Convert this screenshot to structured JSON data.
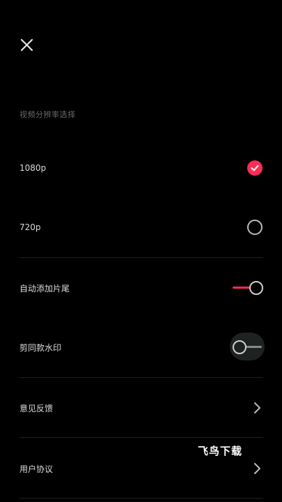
{
  "header": {
    "close_icon": "close-icon"
  },
  "resolution": {
    "section_title": "视频分辨率选择",
    "options": [
      {
        "label": "1080p",
        "selected": true
      },
      {
        "label": "720p",
        "selected": false
      }
    ]
  },
  "toggles": [
    {
      "label": "自动添加片尾",
      "on": true
    },
    {
      "label": "剪同款水印",
      "on": false
    }
  ],
  "links": [
    {
      "label": "意见反馈",
      "icon": "chevron-right-icon"
    },
    {
      "label": "用户协议",
      "icon": "chevron-right-icon"
    }
  ],
  "overlay": {
    "watermark": "飞鸟下载"
  },
  "colors": {
    "accent": "#fe2c55",
    "background": "#000000",
    "divider": "#1f1f1f"
  }
}
